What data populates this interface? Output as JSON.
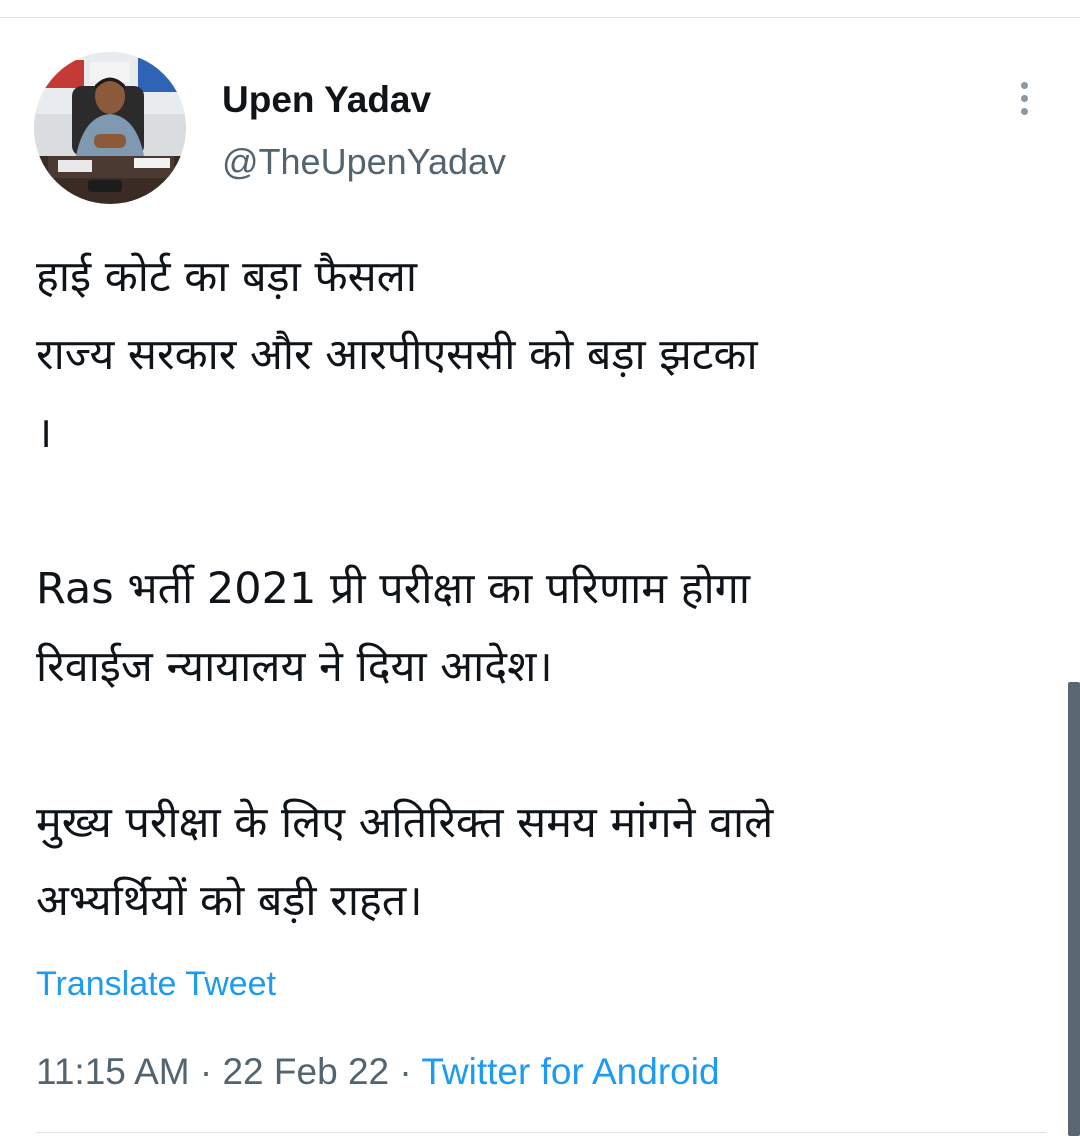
{
  "user": {
    "display_name": "Upen Yadav",
    "handle": "@TheUpenYadav",
    "avatar_icon": "profile-photo"
  },
  "tweet": {
    "lines_block1": [
      "हाई कोर्ट का बड़ा फैसला",
      "राज्य सरकार और आरपीएससी को बड़ा झटका",
      "।"
    ],
    "lines_block2": [
      "Ras भर्ती 2021 प्री परीक्षा का परिणाम होगा",
      "रिवाईज न्यायालय ने दिया आदेश।"
    ],
    "lines_block3": [
      "मुख्य परीक्षा के लिए अतिरिक्त समय मांगने वाले",
      "अभ्यर्थियों को बड़ी राहत।"
    ]
  },
  "translate": {
    "label": "Translate Tweet"
  },
  "meta": {
    "time": "11:15 AM",
    "separator": " · ",
    "date": "22 Feb 22",
    "source": "Twitter for Android"
  },
  "more_icon": "more-vertical-icon",
  "colors": {
    "link": "#1d9bf0",
    "secondary_text": "#536471",
    "primary_text": "#0f1419"
  }
}
